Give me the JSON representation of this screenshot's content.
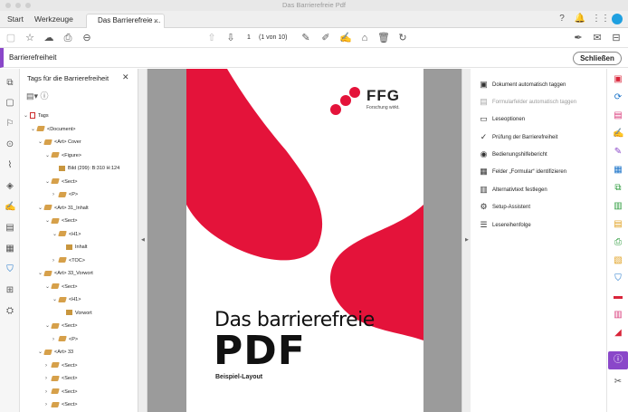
{
  "window": {
    "title": "Das Barrierefreie Pdf"
  },
  "tabs": {
    "start": "Start",
    "tools": "Werkzeuge",
    "document": "Das Barrierefreie ...",
    "close": "×"
  },
  "toolbar": {
    "page_number": "1",
    "page_of": "(1 von 10)"
  },
  "tool": {
    "name": "Barrierefreiheit",
    "close_label": "Schließen"
  },
  "tags_panel": {
    "title": "Tags für die Barrierefreiheit",
    "rows": [
      {
        "label": "Tags",
        "indent": 0,
        "arrow": "⌄",
        "icon": "pdf"
      },
      {
        "label": "<Document>",
        "indent": 1,
        "arrow": "⌄",
        "icon": "tag"
      },
      {
        "label": "<Art> Cover",
        "indent": 2,
        "arrow": "⌄",
        "icon": "tag"
      },
      {
        "label": "<Figure>",
        "indent": 3,
        "arrow": "⌄",
        "icon": "tag"
      },
      {
        "label": "Bild (299): B:310 H:124",
        "indent": 4,
        "arrow": "",
        "icon": "img"
      },
      {
        "label": "<Sect>",
        "indent": 3,
        "arrow": "⌄",
        "icon": "tag"
      },
      {
        "label": "<P>",
        "indent": 4,
        "arrow": "›",
        "icon": "tag"
      },
      {
        "label": "<Art> 31_Inhalt",
        "indent": 2,
        "arrow": "⌄",
        "icon": "tag"
      },
      {
        "label": "<Sect>",
        "indent": 3,
        "arrow": "⌄",
        "icon": "tag"
      },
      {
        "label": "<H1>",
        "indent": 4,
        "arrow": "⌄",
        "icon": "tag"
      },
      {
        "label": "Inhalt",
        "indent": 5,
        "arrow": "",
        "icon": "img"
      },
      {
        "label": "<TOC>",
        "indent": 4,
        "arrow": "›",
        "icon": "tag"
      },
      {
        "label": "<Art> 33_Vorwort",
        "indent": 2,
        "arrow": "⌄",
        "icon": "tag"
      },
      {
        "label": "<Sect>",
        "indent": 3,
        "arrow": "⌄",
        "icon": "tag"
      },
      {
        "label": "<H1>",
        "indent": 4,
        "arrow": "⌄",
        "icon": "tag"
      },
      {
        "label": "Vorwort",
        "indent": 5,
        "arrow": "",
        "icon": "img"
      },
      {
        "label": "<Sect>",
        "indent": 3,
        "arrow": "⌄",
        "icon": "tag"
      },
      {
        "label": "<P>",
        "indent": 4,
        "arrow": "›",
        "icon": "tag"
      },
      {
        "label": "<Art> 33",
        "indent": 2,
        "arrow": "⌄",
        "icon": "tag"
      },
      {
        "label": "<Sect>",
        "indent": 3,
        "arrow": "›",
        "icon": "tag"
      },
      {
        "label": "<Sect>",
        "indent": 3,
        "arrow": "›",
        "icon": "tag"
      },
      {
        "label": "<Sect>",
        "indent": 3,
        "arrow": "›",
        "icon": "tag"
      },
      {
        "label": "<Sect>",
        "indent": 3,
        "arrow": "›",
        "icon": "tag"
      }
    ]
  },
  "document": {
    "logo_text": "FFG",
    "logo_sub": "Forschung wirkt.",
    "title_line1": "Das barrierefreie",
    "title_line2": "PDF",
    "subtitle": "Beispiel-Layout",
    "accent": "#e4133a"
  },
  "actions": [
    {
      "label": "Dokument automatisch taggen",
      "icon": "auto-tag-icon",
      "glyph": "▣",
      "disabled": false
    },
    {
      "label": "Formularfelder automatisch taggen",
      "icon": "form-tag-icon",
      "glyph": "▤",
      "disabled": true
    },
    {
      "label": "Leseoptionen",
      "icon": "reading-options-icon",
      "glyph": "▭",
      "disabled": false
    },
    {
      "label": "Prüfung der Barrierefreiheit",
      "icon": "check-icon",
      "glyph": "✓",
      "disabled": false
    },
    {
      "label": "Bedienungshilfebericht",
      "icon": "report-icon",
      "glyph": "◉",
      "disabled": false
    },
    {
      "label": "Felder „Formular“ identifizieren",
      "icon": "form-fields-icon",
      "glyph": "▦",
      "disabled": false
    },
    {
      "label": "Alternativtext festlegen",
      "icon": "alt-text-icon",
      "glyph": "▥",
      "disabled": false
    },
    {
      "label": "Setup-Assistent",
      "icon": "setup-icon",
      "glyph": "⚙",
      "disabled": false
    },
    {
      "label": "Lesereihenfolge",
      "icon": "reading-order-icon",
      "glyph": "☰",
      "disabled": false
    }
  ]
}
